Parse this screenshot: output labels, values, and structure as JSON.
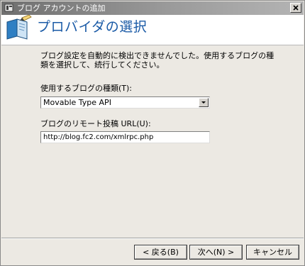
{
  "window": {
    "title": "ブログ アカウントの追加",
    "close_glyph": "✕"
  },
  "header": {
    "title": "プロバイダの選択",
    "icon": "blog-wizard-icon"
  },
  "content": {
    "description": "ブログ設定を自動的に検出できませんでした。使用するブログの種類を選択して、続行してください。",
    "blog_type_label": "使用するブログの種類(T):",
    "blog_type_selected": "Movable Type API",
    "remote_url_label": "ブログのリモート投稿 URL(U):",
    "remote_url_value": "http://blog.fc2.com/xmlrpc.php"
  },
  "buttons": {
    "back": "< 戻る(B)",
    "next": "次へ(N) >",
    "cancel": "キャンセル"
  }
}
